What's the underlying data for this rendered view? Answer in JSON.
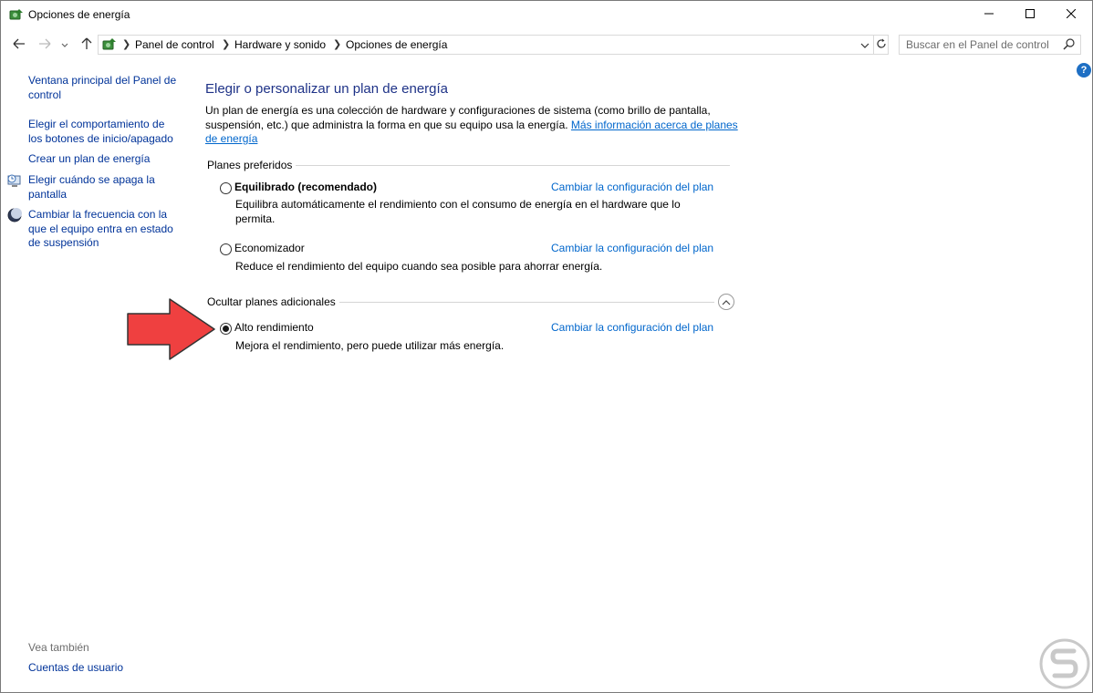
{
  "window": {
    "title": "Opciones de energía",
    "controls": {
      "minimize": "minimize-icon",
      "maximize": "maximize-icon",
      "close": "close-icon"
    }
  },
  "nav": {
    "breadcrumbs": [
      "Panel de control",
      "Hardware y sonido",
      "Opciones de energía"
    ],
    "search_placeholder": "Buscar en el Panel de control"
  },
  "sidebar": {
    "items": [
      {
        "label": "Ventana principal del Panel de control",
        "lines": [
          "Ventana principal del Panel de",
          "control"
        ],
        "icon": null
      },
      {
        "label": "Elegir el comportamiento de los botones de inicio/apagado",
        "lines": [
          "Elegir el comportamiento de",
          "los botones de inicio/apagado"
        ],
        "icon": null
      },
      {
        "label": "Crear un plan de energía",
        "lines": [
          "Crear un plan de energía"
        ],
        "icon": null
      },
      {
        "label": "Elegir cuándo se apaga la pantalla",
        "lines": [
          "Elegir cuándo se apaga la",
          "pantalla"
        ],
        "icon": "monitor-clock-icon"
      },
      {
        "label": "Cambiar la frecuencia con la que el equipo entra en estado de suspensión",
        "lines": [
          "Cambiar la frecuencia con la",
          "que el equipo entra en estado",
          "de suspensión"
        ],
        "icon": "moon-icon"
      }
    ],
    "see_also": {
      "heading": "Vea también",
      "items": [
        {
          "label": "Cuentas de usuario"
        }
      ]
    }
  },
  "main": {
    "title": "Elegir o personalizar un plan de energía",
    "intro_line1": "Un plan de energía es una colección de hardware y configuraciones de sistema (como brillo de pantalla,",
    "intro_line2": "suspensión, etc.) que administra la forma en que su equipo usa la energía.",
    "intro_link_line1": "Más información acerca de planes",
    "intro_link_line2": "de energía",
    "preferred_heading": "Planes preferidos",
    "hidden_heading": "Ocultar planes adicionales",
    "change_link": "Cambiar la configuración del plan",
    "plans": [
      {
        "name": "Equilibrado (recomendado)",
        "selected": false,
        "bold": true,
        "desc_lines": [
          "Equilibra automáticamente el rendimiento con el consumo de energía en el hardware que lo",
          "permita."
        ]
      },
      {
        "name": "Economizador",
        "selected": false,
        "bold": false,
        "desc_lines": [
          "Reduce el rendimiento del equipo cuando sea posible para ahorrar energía."
        ]
      },
      {
        "name": "Alto rendimiento",
        "selected": true,
        "bold": false,
        "desc_lines": [
          "Mejora el rendimiento, pero puede utilizar más energía."
        ]
      }
    ]
  },
  "colors": {
    "link": "#0066cc",
    "title": "#1e3287",
    "sidebar_link": "#003399",
    "arrow_fill": "#ef4040",
    "help": "#1e6fc4"
  }
}
